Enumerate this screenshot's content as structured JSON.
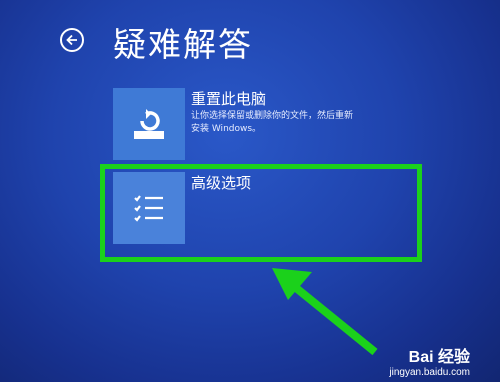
{
  "header": {
    "title": "疑难解答",
    "back_icon": "back-arrow-icon"
  },
  "options": [
    {
      "title": "重置此电脑",
      "description": "让你选择保留或删除你的文件，然后重新安装 Windows。",
      "icon": "reset-refresh-icon"
    },
    {
      "title": "高级选项",
      "description": "",
      "icon": "checklist-icon"
    }
  ],
  "annotation": {
    "highlight_color": "#1bd11b",
    "arrow_color": "#1bd11b"
  },
  "watermark": {
    "logo": "Bai 经验",
    "url": "jingyan.baidu.com"
  },
  "colors": {
    "background": "#1f43ad",
    "tile": "#3f7ad6"
  }
}
